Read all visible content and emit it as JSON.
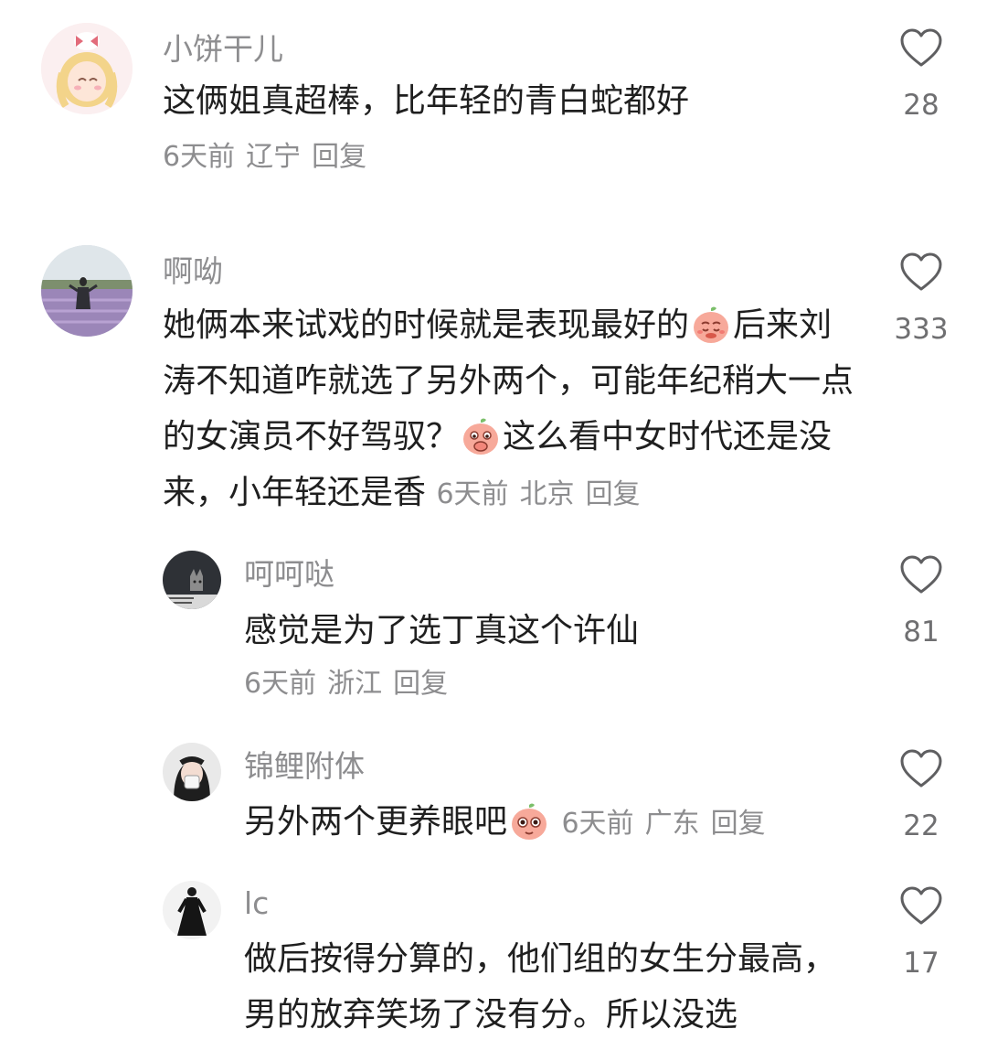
{
  "comments": [
    {
      "username": "小饼干儿",
      "text_parts": [
        "这俩姐真超棒，比年轻的青白蛇都好"
      ],
      "time": "6天前",
      "location": "辽宁",
      "reply_label": "回复",
      "likes": "28"
    },
    {
      "username": "啊呦",
      "text_parts": [
        "她俩本来试戏的时候就是表现最好的",
        "后来刘涛不知道咋就选了另外两个，可能年纪稍大一点的女演员不好驾驭？",
        "这么看中女时代还是没来，小年轻还是香"
      ],
      "time": "6天前",
      "location": "北京",
      "reply_label": "回复",
      "likes": "333",
      "emoji": [
        "pleading-peach-emoji",
        "thinking-peach-emoji"
      ]
    },
    {
      "username": "呵呵哒",
      "text_parts": [
        "感觉是为了选丁真这个许仙"
      ],
      "time": "6天前",
      "location": "浙江",
      "reply_label": "回复",
      "likes": "81"
    },
    {
      "username": "锦鲤附体",
      "text_parts": [
        "另外两个更养眼吧"
      ],
      "time": "6天前",
      "location": "广东",
      "reply_label": "回复",
      "likes": "22",
      "emoji": [
        "wide-eyed-peach-emoji"
      ]
    },
    {
      "username": "lc",
      "text_parts": [
        "做后按得分算的，他们组的女生分最高，男的放弃笑场了没有分。所以没选"
      ],
      "likes": "17"
    }
  ],
  "colors": {
    "text": "#1f1f1f",
    "meta": "#8d8d8f",
    "like_icon": "#5f5f61",
    "emoji_peach": "#f7a99a"
  },
  "icons": {
    "like": "heart-outline-icon"
  }
}
